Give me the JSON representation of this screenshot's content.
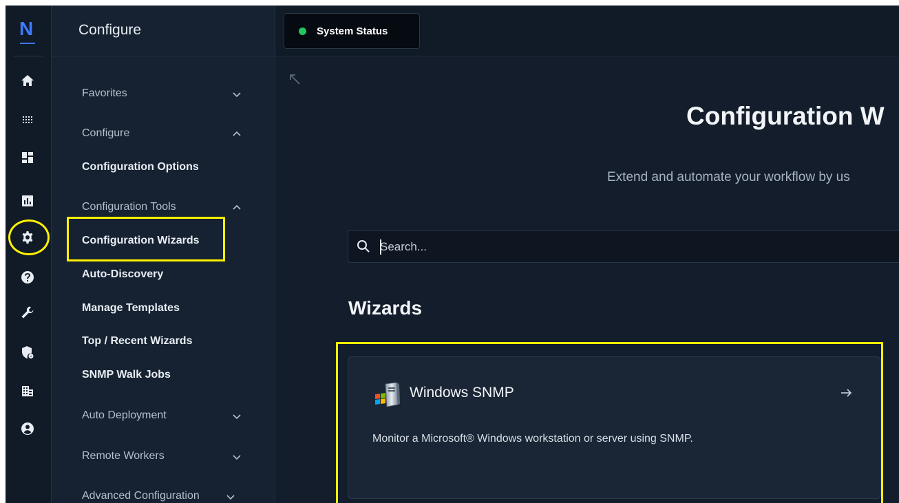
{
  "rail": {
    "logo": "N",
    "icons": [
      "home-icon",
      "apps-grid-icon",
      "dashboard-icon",
      "reports-icon",
      "configure-gear-icon",
      "help-icon",
      "tools-wrench-icon",
      "admin-shield-icon",
      "organization-icon",
      "user-account-icon"
    ],
    "active": "configure-gear-icon"
  },
  "sidebar": {
    "title": "Configure",
    "groups": {
      "favorites": "Favorites",
      "configure": "Configure",
      "configuration_tools": "Configuration Tools",
      "auto_deployment": "Auto Deployment",
      "remote_workers": "Remote Workers",
      "advanced_configuration": "Advanced Configuration"
    },
    "items": {
      "configuration_options": "Configuration Options",
      "configuration_wizards": "Configuration Wizards",
      "auto_discovery": "Auto-Discovery",
      "manage_templates": "Manage Templates",
      "top_recent_wizards": "Top / Recent Wizards",
      "snmp_walk_jobs": "SNMP Walk Jobs"
    },
    "selected": "Configuration Wizards"
  },
  "topbar": {
    "status_label": "System Status",
    "status_color": "#22c55e"
  },
  "main": {
    "title": "Configuration W",
    "subtitle": "Extend and automate your workflow by us",
    "search": {
      "placeholder": "Search..."
    },
    "section_title": "Wizards",
    "wizards": [
      {
        "name": "Windows SNMP",
        "description": "Monitor a Microsoft® Windows workstation or server using SNMP.",
        "icon": "windows-server-icon"
      }
    ]
  },
  "colors": {
    "background": "#111a27",
    "sidebar": "#162231",
    "accent": "#3d7bff",
    "highlight": "#fff200"
  }
}
